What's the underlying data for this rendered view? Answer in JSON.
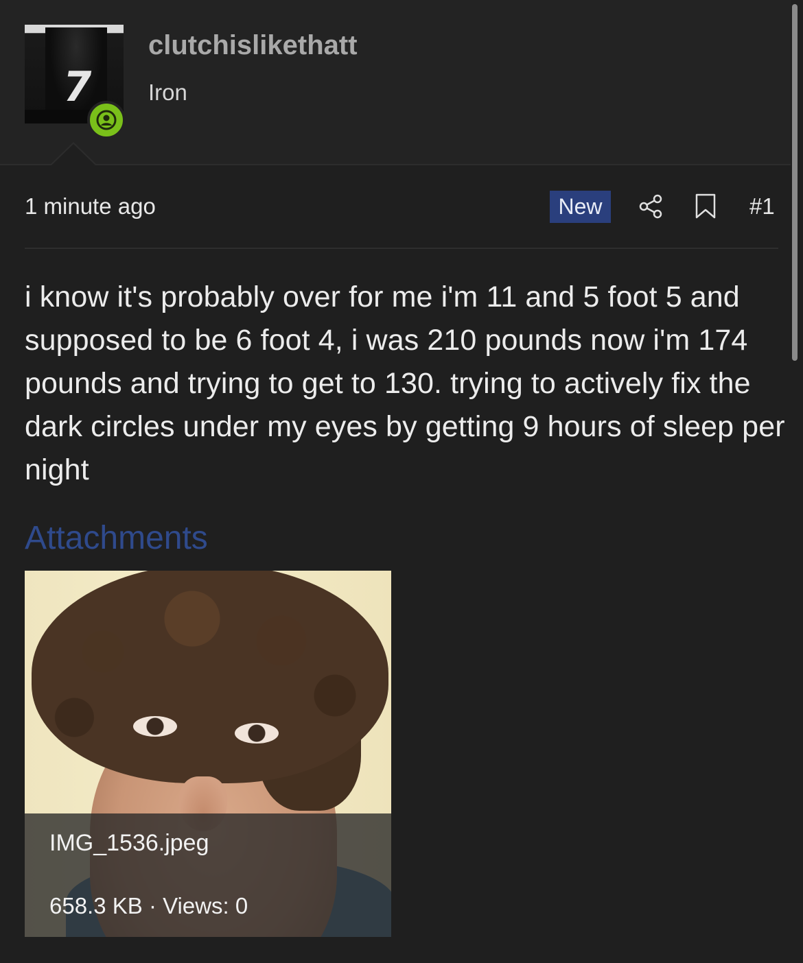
{
  "user": {
    "username": "clutchislikethatt",
    "title": "Iron",
    "status": "online"
  },
  "post": {
    "time": "1 minute ago",
    "badge": "New",
    "number": "#1",
    "body": "i know it's probably over for me i'm 11 and 5 foot 5 and supposed to be 6 foot 4, i was 210 pounds now i'm 174 pounds and trying to get to 130. trying to actively fix the dark circles under my eyes by getting 9 hours of sleep per night"
  },
  "attachments": {
    "heading": "Attachments",
    "items": [
      {
        "filename": "IMG_1536.jpeg",
        "meta": "658.3 KB · Views: 0"
      }
    ]
  },
  "icons": {
    "share": "share-icon",
    "bookmark": "bookmark-icon",
    "online": "user-online-icon"
  },
  "colors": {
    "background": "#1f1f1f",
    "header_background": "#232323",
    "badge_new": "#2a3f7d",
    "online_green": "#7ac01a",
    "attachments_heading": "#2f4a8c",
    "username": "#a9a9a9"
  }
}
